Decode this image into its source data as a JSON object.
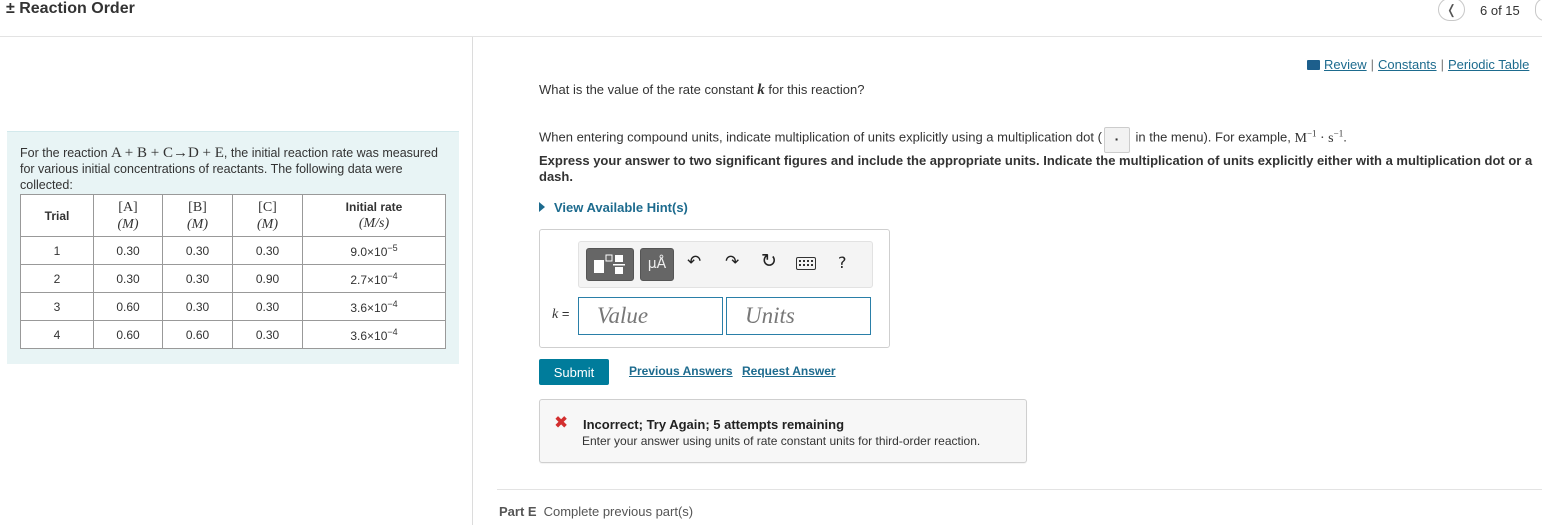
{
  "header": {
    "title": "± Reaction Order",
    "prev_icon": "chevron-left-icon",
    "pager": "6 of 15"
  },
  "problem": {
    "intro_pre": "For the reaction",
    "equation": "A + B + C→D + E",
    "intro_post": ", the initial reaction rate was measured for various initial concentrations of reactants. The following data were collected:",
    "table": {
      "headers": [
        {
          "label": "Trial",
          "unit": ""
        },
        {
          "label": "[A]",
          "unit": "(M)"
        },
        {
          "label": "[B]",
          "unit": "(M)"
        },
        {
          "label": "[C]",
          "unit": "(M)"
        },
        {
          "label": "Initial rate",
          "unit": "(M/s)"
        }
      ],
      "rows": [
        {
          "trial": "1",
          "a": "0.30",
          "b": "0.30",
          "c": "0.30",
          "rate_base": "9.0×10",
          "rate_exp": "−5"
        },
        {
          "trial": "2",
          "a": "0.30",
          "b": "0.30",
          "c": "0.90",
          "rate_base": "2.7×10",
          "rate_exp": "−4"
        },
        {
          "trial": "3",
          "a": "0.60",
          "b": "0.30",
          "c": "0.30",
          "rate_base": "3.6×10",
          "rate_exp": "−4"
        },
        {
          "trial": "4",
          "a": "0.60",
          "b": "0.60",
          "c": "0.30",
          "rate_base": "3.6×10",
          "rate_exp": "−4"
        }
      ]
    }
  },
  "links": {
    "review": "Review",
    "constants": "Constants",
    "periodic_table": "Periodic Table",
    "sep": "|"
  },
  "question": {
    "text_pre": "What is the value of the rate constant",
    "symbol": "k",
    "text_post": "for this reaction?",
    "units_note_pre": "When entering compound units, indicate multiplication of units explicitly using a multiplication dot (",
    "dot_key": "·",
    "units_note_mid": " in the menu). For example, ",
    "units_example_m": "M",
    "units_example_m_exp": "−1",
    "units_example_dot": " · s",
    "units_example_s_exp": "−1",
    "units_note_end": ".",
    "instruction": "Express your answer to two significant figures and include the appropriate units. Indicate the multiplication of units explicitly either with a multiplication dot or a dash.",
    "hints": "View Available Hint(s)"
  },
  "answer": {
    "units_button": "μÅ",
    "help": "?",
    "k_symbol": "k",
    "k_equals": " =",
    "value_placeholder": "Value",
    "units_placeholder": "Units"
  },
  "actions": {
    "submit": "Submit",
    "previous_answers": "Previous Answers",
    "request_answer": "Request Answer"
  },
  "feedback": {
    "icon": "x-icon",
    "title": "Incorrect; Try Again; 5 attempts remaining",
    "message": "Enter your answer using units of rate constant units for third-order reaction."
  },
  "part_e": {
    "label": "Part E",
    "status": "Complete previous part(s)"
  },
  "colors": {
    "accent": "#007c9b",
    "link": "#1d6b8e",
    "error": "#d32f2f",
    "panel_bg": "#e8f4f5"
  }
}
